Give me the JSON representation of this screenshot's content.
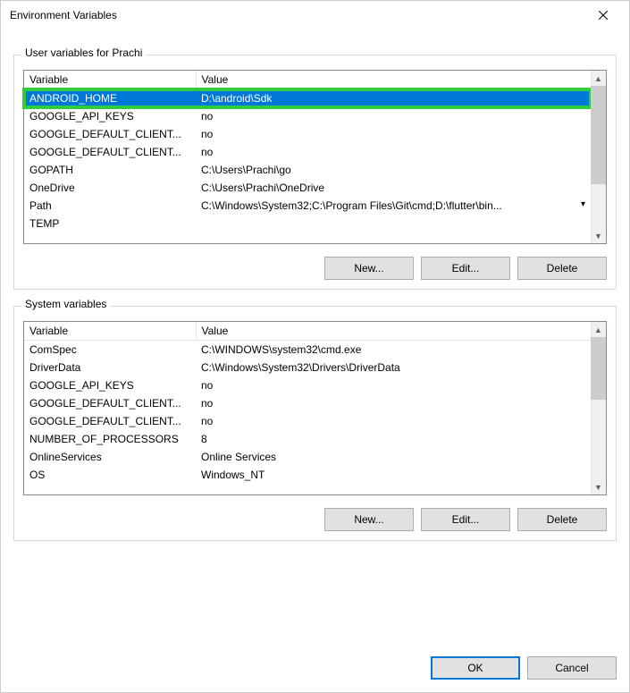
{
  "title": "Environment Variables",
  "user": {
    "legend": "User variables for Prachi",
    "columns": {
      "variable": "Variable",
      "value": "Value"
    },
    "rows": [
      {
        "variable": "ANDROID_HOME",
        "value": "D:\\android\\Sdk",
        "selected": true,
        "highlighted": true
      },
      {
        "variable": "GOOGLE_API_KEYS",
        "value": "no"
      },
      {
        "variable": "GOOGLE_DEFAULT_CLIENT...",
        "value": "no"
      },
      {
        "variable": "GOOGLE_DEFAULT_CLIENT...",
        "value": "no"
      },
      {
        "variable": "GOPATH",
        "value": "C:\\Users\\Prachi\\go"
      },
      {
        "variable": "OneDrive",
        "value": "C:\\Users\\Prachi\\OneDrive"
      },
      {
        "variable": "Path",
        "value": "C:\\Windows\\System32;C:\\Program Files\\Git\\cmd;D:\\flutter\\bin...",
        "ellipsis": true
      },
      {
        "variable": "TEMP",
        "value": ""
      }
    ],
    "buttons": {
      "new": "New...",
      "edit": "Edit...",
      "delete": "Delete"
    }
  },
  "system": {
    "legend": "System variables",
    "columns": {
      "variable": "Variable",
      "value": "Value"
    },
    "rows": [
      {
        "variable": "ComSpec",
        "value": "C:\\WINDOWS\\system32\\cmd.exe"
      },
      {
        "variable": "DriverData",
        "value": "C:\\Windows\\System32\\Drivers\\DriverData"
      },
      {
        "variable": "GOOGLE_API_KEYS",
        "value": "no"
      },
      {
        "variable": "GOOGLE_DEFAULT_CLIENT...",
        "value": "no"
      },
      {
        "variable": "GOOGLE_DEFAULT_CLIENT...",
        "value": "no"
      },
      {
        "variable": "NUMBER_OF_PROCESSORS",
        "value": "8"
      },
      {
        "variable": "OnlineServices",
        "value": "Online Services"
      },
      {
        "variable": "OS",
        "value": "Windows_NT"
      }
    ],
    "buttons": {
      "new": "New...",
      "edit": "Edit...",
      "delete": "Delete"
    }
  },
  "dialog": {
    "ok": "OK",
    "cancel": "Cancel"
  }
}
